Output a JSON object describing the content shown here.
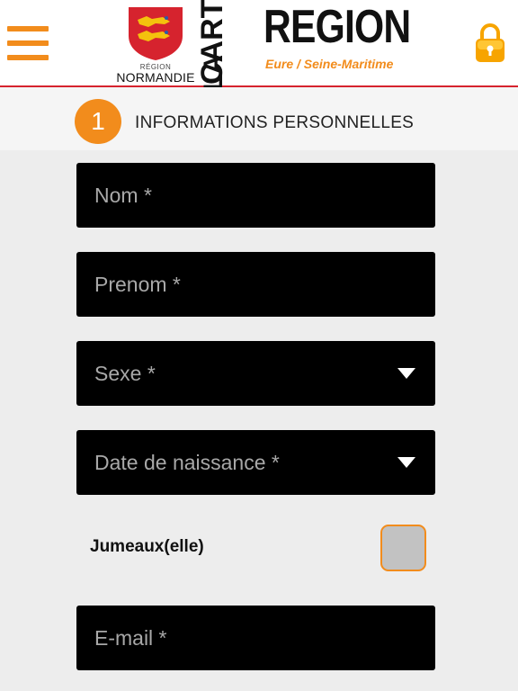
{
  "header": {
    "logo": {
      "region_small": "RÉGION",
      "region_name": "NORMANDIE",
      "vertical_la": "LA",
      "vertical_carte": "CARTE",
      "brand": "REGION",
      "subtitle": "Eure / Seine-Maritime"
    },
    "icons": {
      "menu": "hamburger-menu-icon",
      "lock": "padlock-icon"
    },
    "colors": {
      "accent": "#f28c1c",
      "rule": "#d6232e"
    }
  },
  "section": {
    "step_number": "1",
    "title": "INFORMATIONS PERSONNELLES"
  },
  "form": {
    "nom": {
      "placeholder": "Nom *",
      "value": ""
    },
    "prenom": {
      "placeholder": "Prenom *",
      "value": ""
    },
    "sexe": {
      "label": "Sexe *"
    },
    "date_naissance": {
      "label": "Date de naissance *"
    },
    "jumeaux": {
      "label": "Jumeaux(elle)",
      "checked": false
    },
    "email": {
      "placeholder": "E-mail *",
      "value": ""
    }
  }
}
